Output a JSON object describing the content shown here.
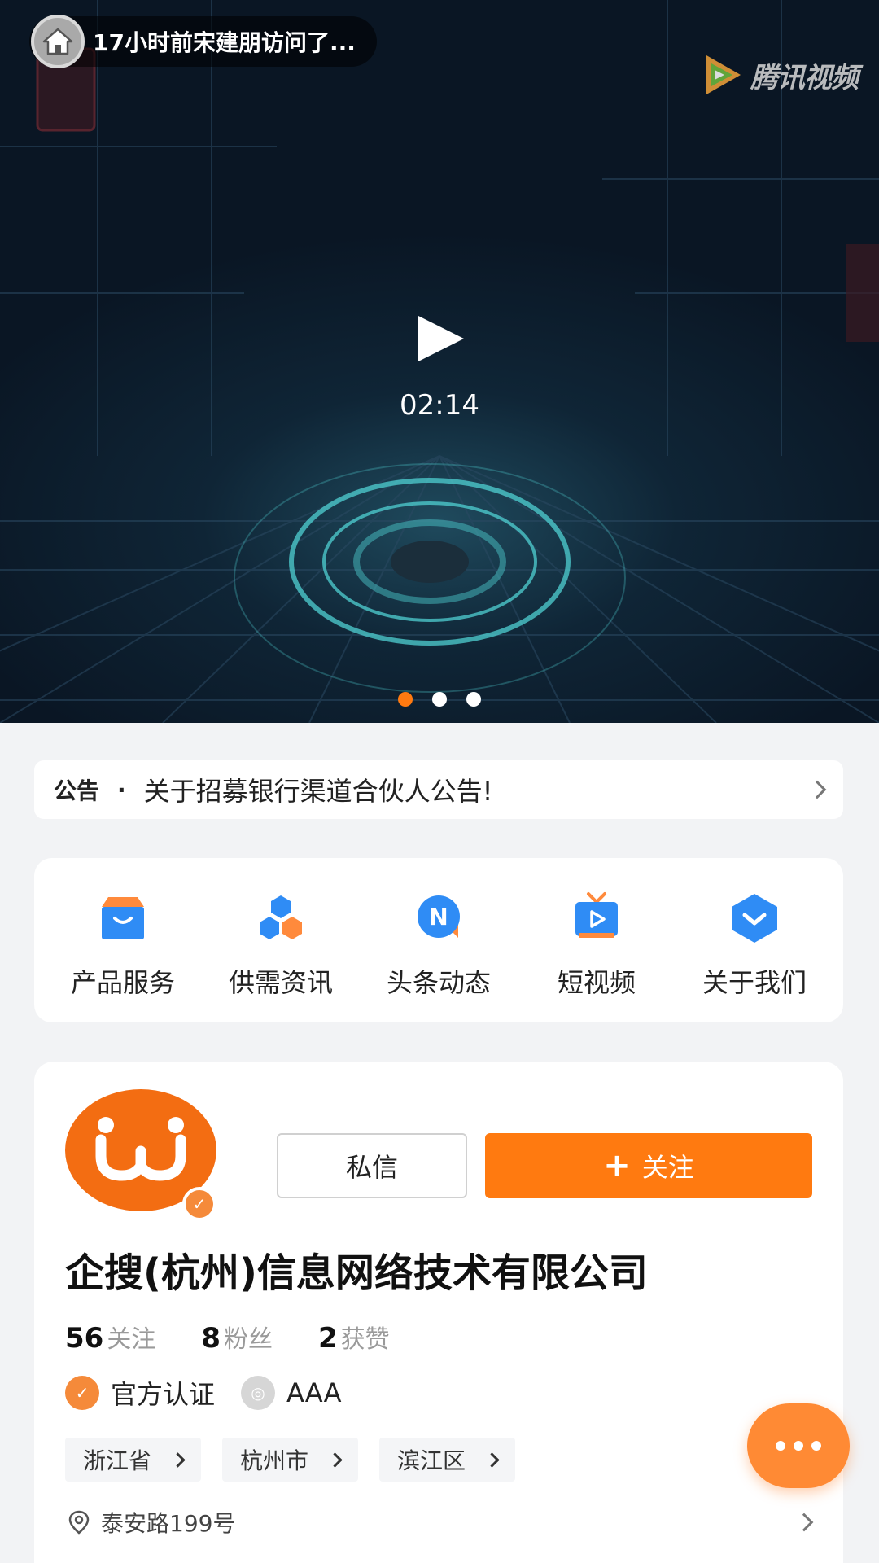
{
  "banner": {
    "visit_text": "17小时前宋建朋访问了...",
    "brand_logo_text": "腾讯视频",
    "duration": "02:14",
    "slides": [
      {
        "active": true
      },
      {
        "active": false
      },
      {
        "active": false
      }
    ],
    "accent_color": "#ff7a10"
  },
  "notice": {
    "tag": "公告",
    "separator": "·",
    "text": "关于招募银行渠道合伙人公告!"
  },
  "menu": {
    "items": [
      {
        "label": "产品服务",
        "icon": "product-box-icon"
      },
      {
        "label": "供需资讯",
        "icon": "cubes-icon"
      },
      {
        "label": "头条动态",
        "icon": "news-n-icon"
      },
      {
        "label": "短视频",
        "icon": "tv-play-icon"
      },
      {
        "label": "关于我们",
        "icon": "chevron-shield-icon"
      }
    ]
  },
  "company": {
    "name": "企搜(杭州)信息网络技术有限公司",
    "message_label": "私信",
    "follow_label": "关注",
    "stats": [
      {
        "value": "56",
        "label": "关注"
      },
      {
        "value": "8",
        "label": "粉丝"
      },
      {
        "value": "2",
        "label": "获赞"
      }
    ],
    "certification": "官方认证",
    "rating": "AAA",
    "regions": [
      "浙江省",
      "杭州市",
      "滨江区"
    ],
    "address": "泰安路199号",
    "brand_color": "#f36d12"
  }
}
